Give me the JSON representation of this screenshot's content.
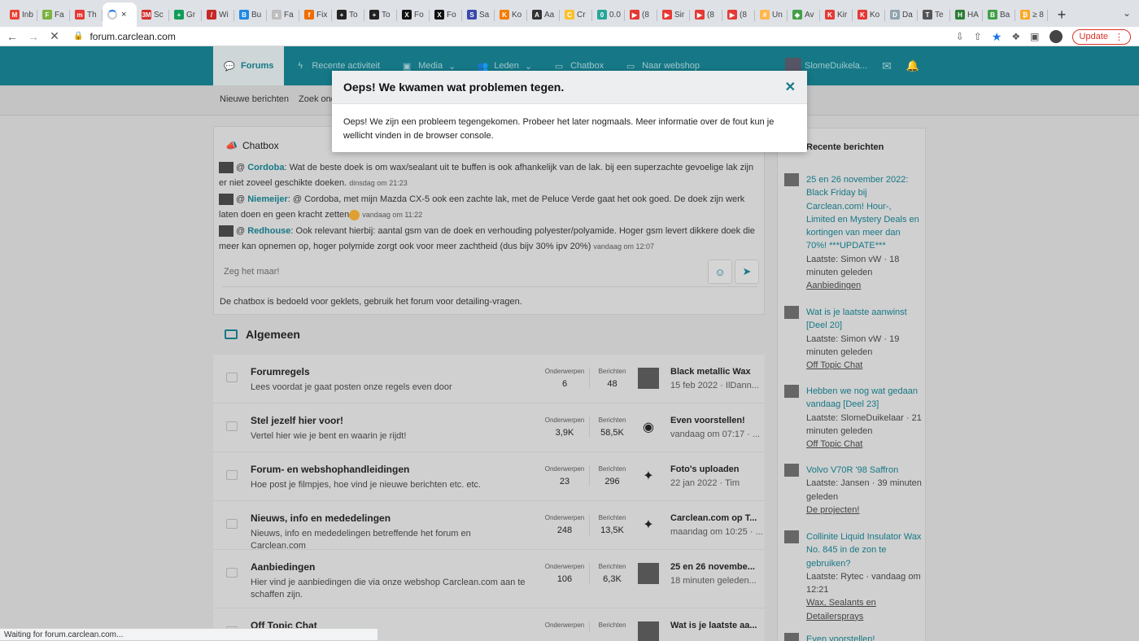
{
  "browser": {
    "tabs": [
      {
        "label": "Inb",
        "color": "#ea4335",
        "glyph": "M"
      },
      {
        "label": "Fa",
        "color": "#7cb342",
        "glyph": "F"
      },
      {
        "label": "Th",
        "color": "#e53935",
        "glyph": "m"
      },
      {
        "label": "",
        "color": "",
        "glyph": "",
        "active": true
      },
      {
        "label": "Sc",
        "color": "#d32f2f",
        "glyph": "3M"
      },
      {
        "label": "Gr",
        "color": "#0f9d58",
        "glyph": "+"
      },
      {
        "label": "Wi",
        "color": "#c62828",
        "glyph": "/"
      },
      {
        "label": "Bu",
        "color": "#1e88e5",
        "glyph": "B"
      },
      {
        "label": "Fa",
        "color": "#bdbdbd",
        "glyph": "x"
      },
      {
        "label": "Fix",
        "color": "#ef6c00",
        "glyph": "f"
      },
      {
        "label": "To",
        "color": "#222222",
        "glyph": "+"
      },
      {
        "label": "To",
        "color": "#222222",
        "glyph": "+"
      },
      {
        "label": "Fo",
        "color": "#111111",
        "glyph": "X"
      },
      {
        "label": "Fo",
        "color": "#111111",
        "glyph": "X"
      },
      {
        "label": "Sa",
        "color": "#3949ab",
        "glyph": "S"
      },
      {
        "label": "Ko",
        "color": "#f57c00",
        "glyph": "K"
      },
      {
        "label": "Aa",
        "color": "#333333",
        "glyph": "A"
      },
      {
        "label": "Cr",
        "color": "#fbc02d",
        "glyph": "C"
      },
      {
        "label": "0.0",
        "color": "#26a69a",
        "glyph": "0"
      },
      {
        "label": "(8",
        "color": "#e53935",
        "glyph": "▶"
      },
      {
        "label": "Sir",
        "color": "#e53935",
        "glyph": "▶"
      },
      {
        "label": "(8",
        "color": "#e53935",
        "glyph": "▶"
      },
      {
        "label": "(8",
        "color": "#e53935",
        "glyph": "▶"
      },
      {
        "label": "Un",
        "color": "#ffb74d",
        "glyph": "#"
      },
      {
        "label": "Av",
        "color": "#43a047",
        "glyph": "◆"
      },
      {
        "label": "Kir",
        "color": "#e53935",
        "glyph": "K"
      },
      {
        "label": "Ko",
        "color": "#e53935",
        "glyph": "K"
      },
      {
        "label": "Da",
        "color": "#90a4ae",
        "glyph": "D"
      },
      {
        "label": "Te",
        "color": "#555555",
        "glyph": "T"
      },
      {
        "label": "HA",
        "color": "#2e7d32",
        "glyph": "H"
      },
      {
        "label": "Ba",
        "color": "#43a047",
        "glyph": "B"
      },
      {
        "label": "≥ 8",
        "color": "#f9a825",
        "glyph": "₿"
      }
    ],
    "new_tab": "+",
    "url": "forum.carclean.com",
    "update_label": "Update",
    "status_text": "Waiting for forum.carclean.com..."
  },
  "site": {
    "nav": [
      {
        "label": "Forums",
        "icon": "chat",
        "active": true
      },
      {
        "label": "Recente activiteit",
        "icon": "bolt"
      },
      {
        "label": "Media",
        "icon": "image",
        "caret": true
      },
      {
        "label": "Leden",
        "icon": "users",
        "caret": true
      },
      {
        "label": "Chatbox",
        "icon": "folder"
      },
      {
        "label": "Naar webshop",
        "icon": "folder"
      }
    ],
    "username": "SlomeDuikela...",
    "subnav": [
      "Nieuwe berichten",
      "Zoek onder"
    ]
  },
  "chatbox": {
    "title": "Chatbox",
    "messages": [
      {
        "user": "Cordoba",
        "text": ": Wat de beste doek is om wax/sealant uit te buffen is ook afhankelijk van de lak. bij een superzachte gevoelige lak zijn er niet zoveel geschikte doeken.",
        "time": "dinsdag om 21:23"
      },
      {
        "user": "Niemeijer",
        "text": ": @ Cordoba, met mijn Mazda CX-5 ook een zachte lak, met de Peluce Verde gaat het ook goed. De doek zijn werk laten doen en geen kracht zetten",
        "time": "vandaag om 11:22",
        "emoji": true
      },
      {
        "user": "Redhouse",
        "text": ": Ook relevant hierbij: aantal gsm van de doek en verhouding polyester/polyamide. Hoger gsm levert dikkere doek die meer kan opnemen op, hoger polymide zorgt ook voor meer zachtheid (dus bijv 30% ipv 20%)",
        "time": "vandaag om 12:07"
      }
    ],
    "input_placeholder": "Zeg het maar!",
    "note": "De chatbox is bedoeld voor geklets, gebruik het forum voor detailing-vragen."
  },
  "section_title": "Algemeen",
  "stat_labels": {
    "topics": "Onderwerpen",
    "posts": "Berichten"
  },
  "forums": [
    {
      "title": "Forumregels",
      "desc": "Lees voordat je gaat posten onze regels even door",
      "topics": "6",
      "posts": "48",
      "last_title": "Black metallic Wax",
      "last_meta": "15 feb 2022 · IlDann...",
      "avatar": "photo"
    },
    {
      "title": "Stel jezelf hier voor!",
      "desc": "Vertel hier wie je bent en waarin je rijdt!",
      "topics": "3,9K",
      "posts": "58,5K",
      "last_title": "Even voorstellen!",
      "last_meta": "vandaag om 07:17 · ...",
      "avatar": "yoda"
    },
    {
      "title": "Forum- en webshophandleidingen",
      "desc": "Hoe post je filmpjes, hoe vind je nieuwe berichten etc. etc.",
      "topics": "23",
      "posts": "296",
      "last_title": "Foto's uploaden",
      "last_meta": "22 jan 2022 · Tim",
      "avatar": "sparkle"
    },
    {
      "title": "Nieuws, info en mededelingen",
      "desc": "Nieuws, info en mededelingen betreffende het forum en Carclean.com",
      "topics": "248",
      "posts": "13,5K",
      "last_title": "Carclean.com op T...",
      "last_meta": "maandag om 10:25 · ...",
      "avatar": "sparkle"
    },
    {
      "title": "Aanbiedingen",
      "desc": "Hier vind je aanbiedingen die via onze webshop Carclean.com aan te schaffen zijn.",
      "topics": "106",
      "posts": "6,3K",
      "last_title": "25 en 26 novembe...",
      "last_meta": "18 minuten geleden...",
      "avatar": "photo",
      "tall": true
    },
    {
      "title": "Off Topic Chat",
      "desc": "",
      "topics": "",
      "posts": "",
      "last_title": "Wat is je laatste aa...",
      "last_meta": "",
      "avatar": "photo"
    }
  ],
  "sidebar": {
    "title": "Recente berichten",
    "items": [
      {
        "title": "25 en 26 november 2022: Black Friday bij Carclean.com! Hour-, Limited en Mystery Deals en kortingen van meer dan 70%! ***UPDATE***",
        "meta": "Laatste: Simon vW · 18 minuten geleden",
        "forum": "Aanbiedingen"
      },
      {
        "title": "Wat is je laatste aanwinst [Deel 20]",
        "meta": "Laatste: Simon vW · 19 minuten geleden",
        "forum": "Off Topic Chat"
      },
      {
        "title": "Hebben we nog wat gedaan vandaag [Deel 23]",
        "meta": "Laatste: SlomeDuikelaar · 21 minuten geleden",
        "forum": "Off Topic Chat"
      },
      {
        "title": "Volvo V70R '98 Saffron",
        "meta": "Laatste: Jansen · 39 minuten geleden",
        "forum": "De projecten!"
      },
      {
        "title": "Collinite Liquid Insulator Wax No. 845 in de zon te gebruiken?",
        "meta": "Laatste: Rytec · vandaag om 12:21",
        "forum": "Wax, Sealants en Detailersprays"
      },
      {
        "title": "Even voorstellen!",
        "meta": "",
        "forum": ""
      }
    ]
  },
  "modal": {
    "title": "Oeps! We kwamen wat problemen tegen.",
    "body": "Oeps! We zijn een probleem tegengekomen. Probeer het later nogmaals. Meer informatie over de fout kun je wellicht vinden in de browser console."
  },
  "colors": {
    "brand": "#167886",
    "error": "#d93025"
  }
}
